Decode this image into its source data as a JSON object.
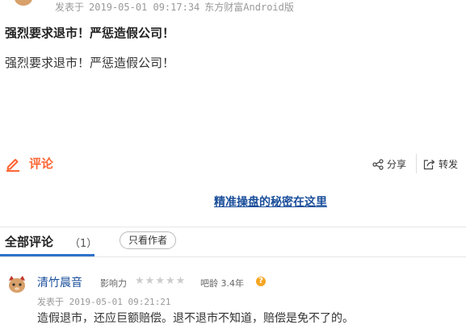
{
  "post": {
    "published_prefix": "发表于",
    "published_time": "2019-05-01 09:17:34",
    "source": "东方财富Android版",
    "title": "强烈要求退市！严惩造假公司！",
    "body": "强烈要求退市！严惩造假公司！"
  },
  "actions": {
    "comment_label": "评论",
    "share_label": "分享",
    "forward_label": "转发"
  },
  "promo": {
    "link_text": "精准操盘的秘密在这里"
  },
  "comments_section": {
    "title": "全部评论",
    "count": "（1）",
    "author_only_label": "只看作者"
  },
  "comments": [
    {
      "username": "清竹晨音",
      "influence_label": "影响力",
      "stars": 0,
      "stars_total": 5,
      "bar_age_label": "吧龄",
      "bar_age": "3.4年",
      "help": "?",
      "published_prefix": "发表于",
      "published_time": "2019-05-01 09:21:21",
      "text": "造假退市，还应巨额赔偿。退不退市不知道，赔偿是免不了的。"
    }
  ],
  "colors": {
    "accent": "#ff6633",
    "link": "#1a4e9a",
    "tab": "#2e73c9",
    "help": "#f5a623"
  },
  "icons": [
    "avatar-icon",
    "pencil-icon",
    "share-icon",
    "forward-icon",
    "star-icon",
    "help-icon"
  ]
}
